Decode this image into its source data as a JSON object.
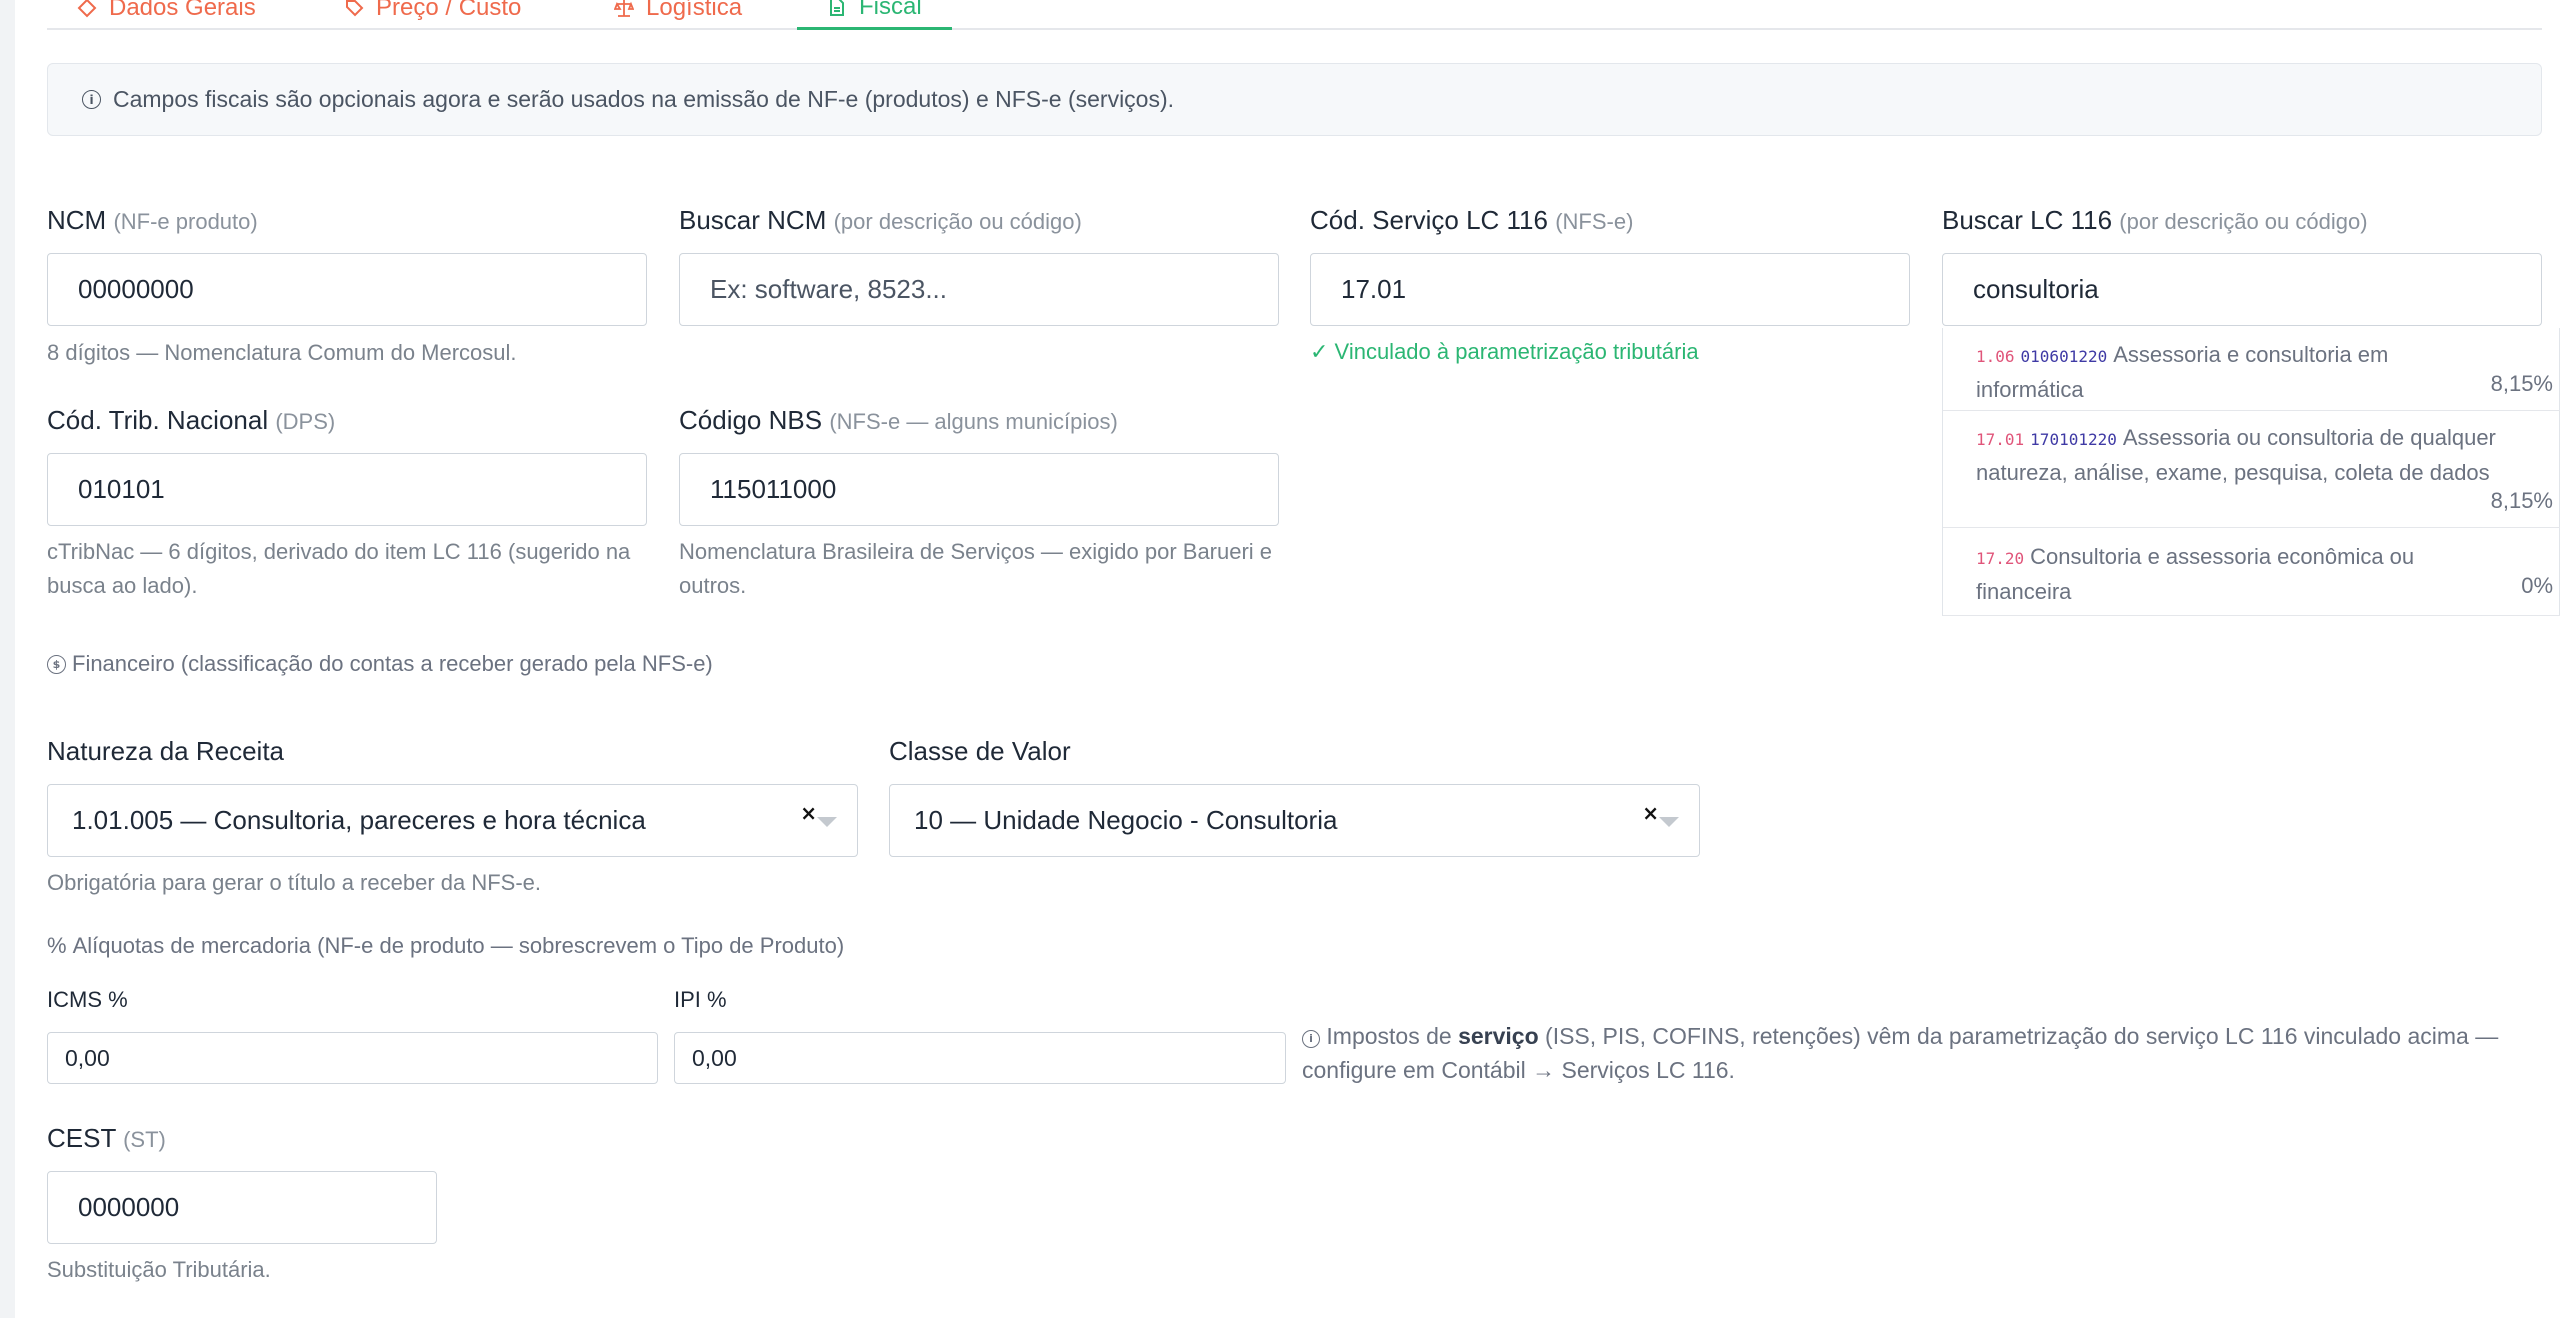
{
  "tabs": [
    {
      "label": "Dados Gerais",
      "icon": "diamond-icon"
    },
    {
      "label": "Preço / Custo",
      "icon": "tag-icon"
    },
    {
      "label": "Logística",
      "icon": "scale-icon"
    },
    {
      "label": "Fiscal",
      "icon": "document-icon",
      "active": true
    }
  ],
  "info_banner": "Campos fiscais são opcionais agora e serão usados na emissão de NF-e (produtos) e NFS-e (serviços).",
  "fields": {
    "ncm": {
      "label": "NCM",
      "sub": "(NF-e produto)",
      "value": "00000000",
      "hint": "8 dígitos — Nomenclatura Comum do Mercosul."
    },
    "buscar_ncm": {
      "label": "Buscar NCM",
      "sub": "(por descrição ou código)",
      "placeholder": "Ex: software, 8523..."
    },
    "cod_servico": {
      "label": "Cód. Serviço LC 116",
      "sub": "(NFS-e)",
      "value": "17.01",
      "status": "✓ Vinculado à parametrização tributária"
    },
    "buscar_lc": {
      "label": "Buscar LC 116",
      "sub": "(por descrição ou código)",
      "value": "consultoria"
    },
    "cod_trib": {
      "label": "Cód. Trib. Nacional",
      "sub": "(DPS)",
      "value": "010101",
      "hint": "cTribNac — 6 dígitos, derivado do item LC 116 (sugerido na busca ao lado)."
    },
    "nbs": {
      "label": "Código NBS",
      "sub": "(NFS-e — alguns municípios)",
      "value": "115011000",
      "hint": "Nomenclatura Brasileira de Serviços — exigido por Barueri e outros."
    }
  },
  "lc_results": [
    {
      "code": "1.06",
      "ctrib": "010601220",
      "desc": "Assessoria e consultoria em informática",
      "rate": "8,15%"
    },
    {
      "code": "17.01",
      "ctrib": "170101220",
      "desc": "Assessoria ou consultoria de qualquer natureza, análise, exame, pesquisa, coleta de dados",
      "rate": "8,15%"
    },
    {
      "code": "17.20",
      "ctrib": "",
      "desc": "Consultoria e assessoria econômica ou financeira",
      "rate": "0%"
    }
  ],
  "financeiro": {
    "section": "Financeiro (classificação do contas a receber gerado pela NFS-e)",
    "natureza": {
      "label": "Natureza da Receita",
      "value": "1.01.005 — Consultoria, pareceres e hora técnica",
      "hint": "Obrigatória para gerar o título a receber da NFS-e."
    },
    "classe": {
      "label": "Classe de Valor",
      "value": "10 — Unidade Negocio - Consultoria"
    },
    "clear_glyph": "×"
  },
  "aliquotas": {
    "section": "Alíquotas de mercadoria (NF-e de produto — sobrescrevem o Tipo de Produto)",
    "icms": {
      "label": "ICMS %",
      "value": "0,00"
    },
    "ipi": {
      "label": "IPI %",
      "value": "0,00"
    },
    "note_pre": "Impostos de ",
    "note_bold": "serviço",
    "note_post": " (ISS, PIS, COFINS, retenções) vêm da parametrização do serviço LC 116 vinculado acima — configure em Contábil → Serviços LC 116."
  },
  "cest": {
    "label": "CEST",
    "sub": "(ST)",
    "value": "0000000",
    "hint": "Substituição Tributária."
  },
  "colors": {
    "accent_green": "#2bb673",
    "tab_orange": "#ef6a4c",
    "code_pink": "#e0557a",
    "code_purple": "#3f3aa5"
  }
}
